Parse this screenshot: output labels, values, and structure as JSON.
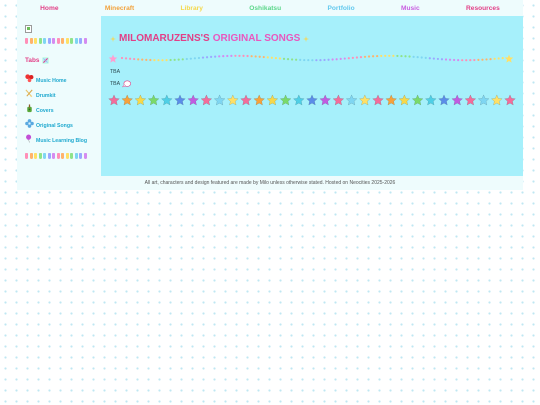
{
  "nav": {
    "items": [
      {
        "label": "Home",
        "color": "#e23f87"
      },
      {
        "label": "Minecraft",
        "color": "#f2a23c"
      },
      {
        "label": "Library",
        "color": "#f5d84b"
      },
      {
        "label": "Oshikatsu",
        "color": "#5cd68a"
      },
      {
        "label": "Portfolio",
        "color": "#63c9ee"
      },
      {
        "label": "Music",
        "color": "#c85de0"
      },
      {
        "label": "Resources",
        "color": "#e23f87"
      }
    ]
  },
  "sidebar": {
    "heading": "Tabs",
    "links": [
      {
        "label": "Music Home",
        "icon": "red-bow-icon"
      },
      {
        "label": "Drumkit",
        "icon": "drumsticks-icon"
      },
      {
        "label": "Covers",
        "icon": "green-guitar-icon"
      },
      {
        "label": "Original Songs",
        "icon": "blue-flower-icon"
      },
      {
        "label": "Music Learning Blog",
        "icon": "purple-balloon-icon"
      }
    ]
  },
  "main": {
    "title_part1": "MILOMARUZENS'S",
    "title_part2": "ORIGINAL SONGS",
    "tba_1": "TBA",
    "tba_2": "TBA"
  },
  "footer": {
    "text": "All art, characters and design featured are made by Milo unless otherwise stated. Hosted on Neocities 2025-2026"
  },
  "colors": {
    "accent_pink": "#e23f87",
    "main_bg": "#a6f0fb",
    "panel_bg": "#eefcfd"
  }
}
